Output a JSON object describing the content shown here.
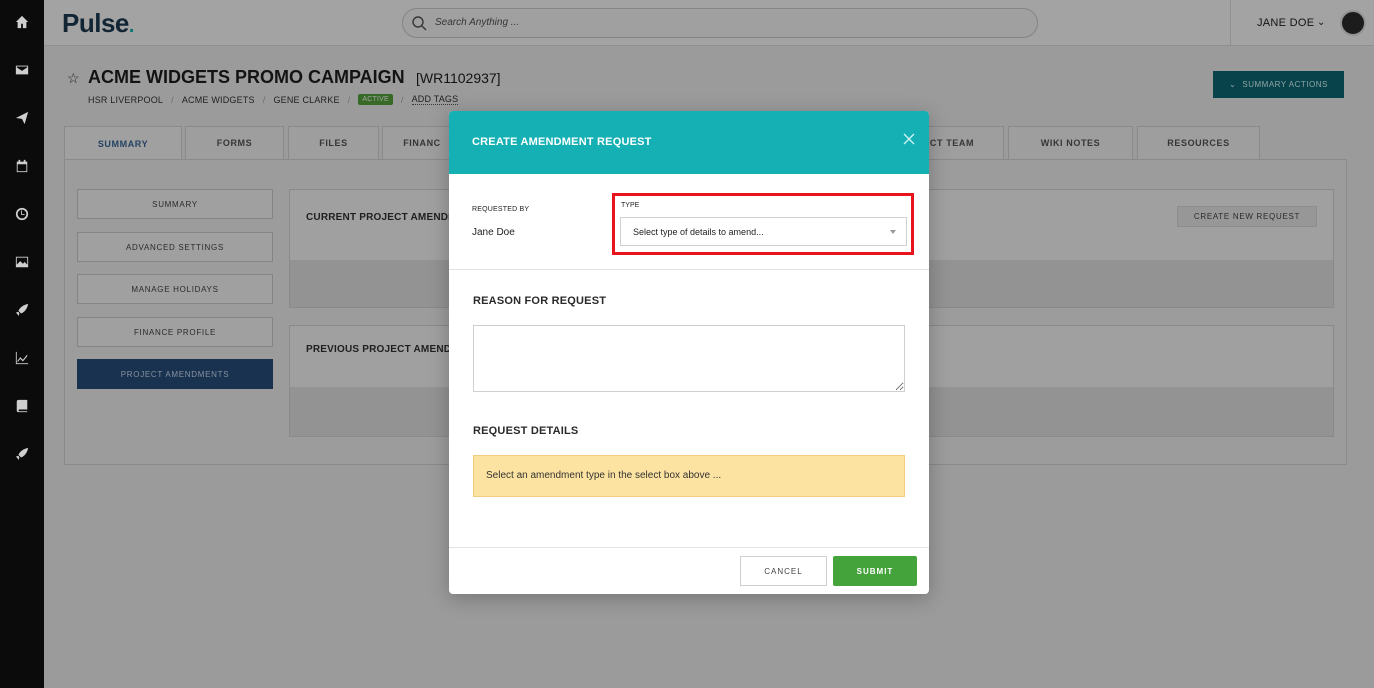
{
  "app": {
    "logo": "Pulse"
  },
  "search": {
    "placeholder": "Search Anything ..."
  },
  "user": {
    "name": "JANE DOE"
  },
  "project": {
    "title": "ACME WIDGETS PROMO CAMPAIGN",
    "ref": "[WR1102937]",
    "crumbs": [
      "HSR LIVERPOOL",
      "ACME WIDGETS",
      "GENE CLARKE"
    ],
    "status": "ACTIVE",
    "add_tags": "ADD TAGS",
    "summary_actions": "SUMMARY ACTIONS"
  },
  "tabs": [
    "SUMMARY",
    "FORMS",
    "FILES",
    "FINANC",
    "CT TEAM",
    "WIKI NOTES",
    "RESOURCES"
  ],
  "sidebar": [
    "SUMMARY",
    "ADVANCED SETTINGS",
    "MANAGE HOLIDAYS",
    "FINANCE PROFILE",
    "PROJECT AMENDMENTS"
  ],
  "panels": {
    "current": "CURRENT PROJECT AMENDM",
    "previous": "PREVIOUS PROJECT AMENDM",
    "create_new": "CREATE NEW REQUEST"
  },
  "modal": {
    "title": "CREATE AMENDMENT REQUEST",
    "requested_by_label": "REQUESTED BY",
    "requested_by_value": "Jane Doe",
    "type_label": "TYPE",
    "type_placeholder": "Select type of details to amend...",
    "reason_heading": "REASON FOR REQUEST",
    "details_heading": "REQUEST DETAILS",
    "details_notice": "Select an amendment type in the select box above ...",
    "cancel": "CANCEL",
    "submit": "SUBMIT"
  },
  "colors": {
    "accent": "#14b0b3",
    "submit": "#44a33a",
    "highlight": "#e8131b",
    "notice": "#fde3a1",
    "sidebar_active": "#274f7d"
  },
  "icons": [
    "home-icon",
    "mail-icon",
    "send-icon",
    "calendar-icon",
    "clock-icon",
    "image-icon",
    "rocket-icon",
    "chart-icon",
    "book-icon",
    "rocket-icon",
    "search-icon",
    "star-icon",
    "chevron-down-icon",
    "close-icon"
  ]
}
